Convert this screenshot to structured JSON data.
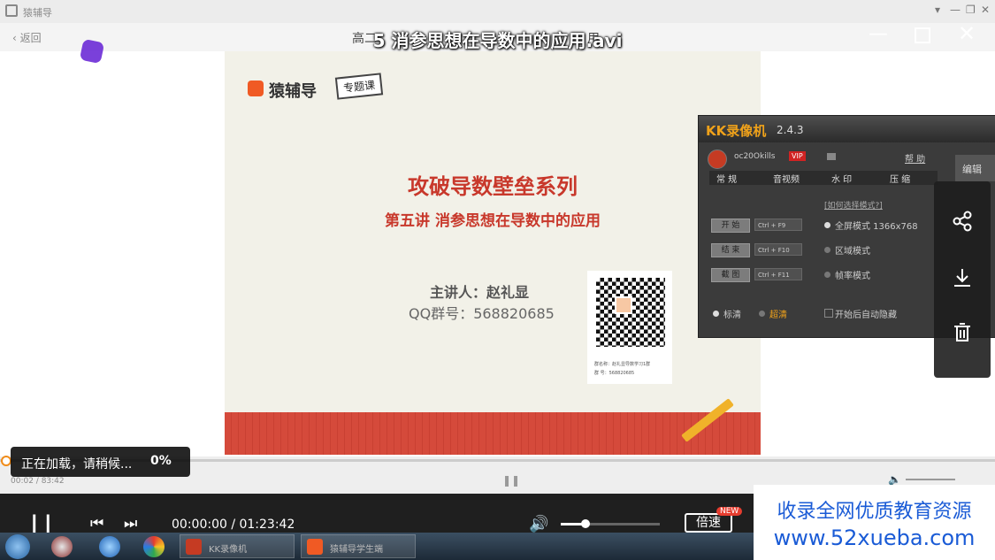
{
  "app": {
    "title": "猿辅导",
    "top_right_glyphs": [
      "▾",
      "—",
      "❐",
      "✕"
    ]
  },
  "page": {
    "back_label": "返回",
    "course_title_left": "高二",
    "course_title_right": "用"
  },
  "window": {
    "title": "5 消参思想在导数中的应用.avi"
  },
  "slide": {
    "brand_name": "猿辅导",
    "brand_tag": "专题课",
    "title": "攻破导数壁垒系列",
    "subtitle": "第五讲  消参思想在导数中的应用",
    "lecturer": "主讲人：赵礼显",
    "qq": "QQ群号：568820685",
    "qr_caption_1": "群名称：赵礼显导数学习1群",
    "qr_caption_2": "群  号：568820685"
  },
  "kk_recorder": {
    "name": "KK录像机",
    "version": "2.4.3",
    "user": "oc20Okills",
    "vip": "VIP",
    "help": "帮 助",
    "tabs": [
      "常 规",
      "音视频",
      "水 印",
      "压 缩"
    ],
    "howto": "[如何选择模式?]",
    "buttons": [
      {
        "label": "开 始",
        "key": "Ctrl + F9"
      },
      {
        "label": "结 束",
        "key": "Ctrl + F10"
      },
      {
        "label": "截 图",
        "key": "Ctrl + F11"
      }
    ],
    "modes": [
      "全屏模式 1366x768",
      "区域模式",
      "帧率模式"
    ],
    "quality": [
      "标清",
      "超清"
    ],
    "autohide": "开始后自动隐藏",
    "side_button": "编辑"
  },
  "side_menu": {
    "icons": [
      "share-icon",
      "download-icon",
      "trash-icon"
    ]
  },
  "player": {
    "small_time": "00:02 / 83:42",
    "loading_text": "正在加载，请稍候...",
    "loading_percent": "0%",
    "time": "00:00:00 / 01:23:42",
    "speed_label": "倍速",
    "new_badge": "NEW",
    "volume": 0.25
  },
  "taskbar": {
    "tasks": [
      "KK录像机",
      "猿辅导学生端"
    ]
  },
  "watermark": {
    "line1": "收录全网优质教育资源",
    "line2": "www.52xueba.com"
  }
}
